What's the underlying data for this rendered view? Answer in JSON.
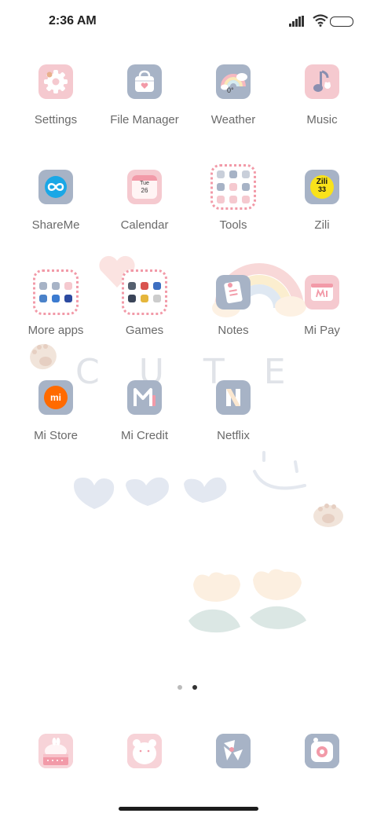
{
  "status": {
    "time": "2:36 AM"
  },
  "decor": {
    "cute_text": "C U T E"
  },
  "apps": [
    {
      "label": "Settings"
    },
    {
      "label": "File Manager"
    },
    {
      "label": "Weather",
      "temp": "0°"
    },
    {
      "label": "Music"
    },
    {
      "label": "ShareMe"
    },
    {
      "label": "Calendar",
      "day": "Tue",
      "date": "26"
    },
    {
      "label": "Tools"
    },
    {
      "label": "Zili",
      "logo_text": "Zili",
      "logo_digits": "33"
    },
    {
      "label": "More apps"
    },
    {
      "label": "Games"
    },
    {
      "label": "Notes"
    },
    {
      "label": "Mi Pay"
    },
    {
      "label": "Mi Store",
      "logo_text": "mi"
    },
    {
      "label": "Mi Credit"
    },
    {
      "label": "Netflix"
    }
  ],
  "page_indicator": {
    "pages": 2,
    "active": 2
  },
  "colors": {
    "icon_pink": "#f5c9cf",
    "icon_blue": "#a7b3c6",
    "label_gray": "#6a6a6a"
  }
}
